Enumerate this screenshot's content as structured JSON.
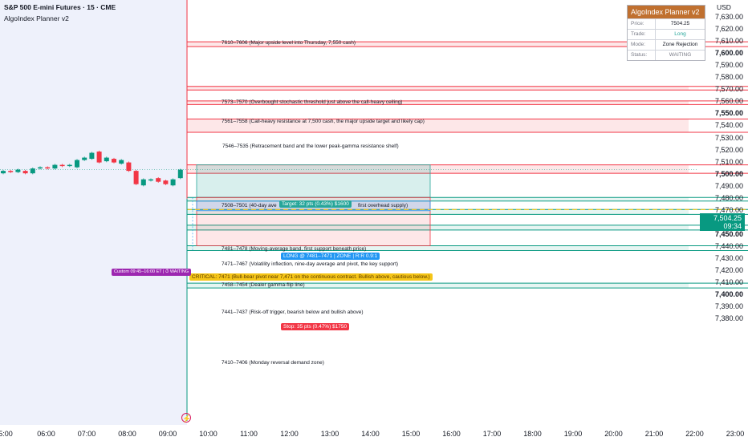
{
  "header": {
    "symbol": "S&P 500 E-mini Futures · 15 · CME",
    "indicator": "AlgoIndex Planner v2",
    "currency": "USD"
  },
  "panel": {
    "title": "AlgoIndex Planner v2",
    "rows": [
      {
        "key": "Price:",
        "value": "7504.25",
        "color": "#131722"
      },
      {
        "key": "Trade:",
        "value": "Long",
        "color": "#26a69a"
      },
      {
        "key": "Mode:",
        "value": "Zone Rejection",
        "color": "#131722"
      },
      {
        "key": "Status:",
        "value": "WAITING",
        "color": "#787b86"
      }
    ]
  },
  "price_axis": [
    "7,630.00",
    "7,620.00",
    "7,610.00",
    "7,600.00",
    "7,590.00",
    "7,580.00",
    "7,570.00",
    "7,560.00",
    "7,550.00",
    "7,540.00",
    "7,530.00",
    "7,520.00",
    "7,510.00",
    "7,500.00",
    "7,490.00",
    "7,480.00",
    "7,470.00",
    "7,460.00",
    "7,450.00",
    "7,440.00",
    "7,430.00",
    "7,420.00",
    "7,410.00",
    "7,400.00",
    "7,390.00",
    "7,380.00"
  ],
  "time_axis": [
    "5:00",
    "06:00",
    "07:00",
    "08:00",
    "09:00",
    "10:00",
    "11:00",
    "12:00",
    "13:00",
    "14:00",
    "15:00",
    "16:00",
    "17:00",
    "18:00",
    "19:00",
    "20:00",
    "21:00",
    "22:00",
    "23:00"
  ],
  "current_price": {
    "value": "7,504.25",
    "countdown": "09:34"
  },
  "zones": [
    {
      "label": "7610–7606 (Major upside level into Thursday, 7,550 cash)",
      "kind": "res"
    },
    {
      "label": "7573–7570 (Overbought stochastic threshold just above the call-heavy ceiling)",
      "kind": "res"
    },
    {
      "label": "7561–7558 (Call-heavy resistance at 7,500 cash, the major upside target and likely cap)",
      "kind": "res"
    },
    {
      "label": "7546–7535 (Retracement band and the lower peak-gamma resistance shelf)",
      "kind": "res"
    },
    {
      "label": "7508–7501 (40-day ave",
      "kind": "res"
    },
    {
      "label": "first overhead supply)",
      "kind": "res"
    },
    {
      "label": "7481–7478 (Moving-average band, first support beneath price)",
      "kind": "sup"
    },
    {
      "label": "7471–7467 (Volatility inflection, nine-day average and pivot, the key support)",
      "kind": "sup"
    },
    {
      "label": "7458–7454 (Dealer gamma-flip line)",
      "kind": "sup"
    },
    {
      "label": "7441–7437 (Risk-off trigger, bearish below and bullish above)",
      "kind": "sup"
    },
    {
      "label": "7410–7406 (Monday reversal demand zone)",
      "kind": "sup"
    }
  ],
  "trade": {
    "target": "Target: 32 pts (0.43%) $1600",
    "entry": "LONG @ 7481–7471 | ZONE | R:R 0.9:1",
    "stop": "Stop: 35 pts (0.47%) $1750",
    "critical": "CRITICAL: 7471 (Bull-bear pivot near 7,471 on the continuous contract. Bullish above, cautious below.)",
    "custom": "Custom 09:45–16:00 ET | ⏱ WAITING"
  },
  "colors": {
    "res": "#f23645",
    "sup": "#089981",
    "target": "#26a69a",
    "entry": "#2196f3",
    "stop": "#f23645",
    "critical": "#f5c518",
    "custom": "#9c27b0"
  },
  "candles": [
    {
      "o": 7501,
      "c": 7503
    },
    {
      "o": 7503,
      "c": 7502
    },
    {
      "o": 7502,
      "c": 7504
    },
    {
      "o": 7503,
      "c": 7501
    },
    {
      "o": 7501,
      "c": 7505
    },
    {
      "o": 7505,
      "c": 7506
    },
    {
      "o": 7506,
      "c": 7505
    },
    {
      "o": 7505,
      "c": 7508
    },
    {
      "o": 7508,
      "c": 7507
    },
    {
      "o": 7507,
      "c": 7508
    },
    {
      "o": 7506,
      "c": 7512
    },
    {
      "o": 7512,
      "c": 7514
    },
    {
      "o": 7513,
      "c": 7518
    },
    {
      "o": 7519,
      "c": 7510
    },
    {
      "o": 7511,
      "c": 7514
    },
    {
      "o": 7513,
      "c": 7510
    },
    {
      "o": 7509,
      "c": 7512
    },
    {
      "o": 7510,
      "c": 7503
    },
    {
      "o": 7503,
      "c": 7492
    },
    {
      "o": 7491,
      "c": 7496
    },
    {
      "o": 7495,
      "c": 7496
    },
    {
      "o": 7497,
      "c": 7494
    },
    {
      "o": 7495,
      "c": 7492
    },
    {
      "o": 7491,
      "c": 7496
    },
    {
      "o": 7497,
      "c": 7504
    }
  ]
}
